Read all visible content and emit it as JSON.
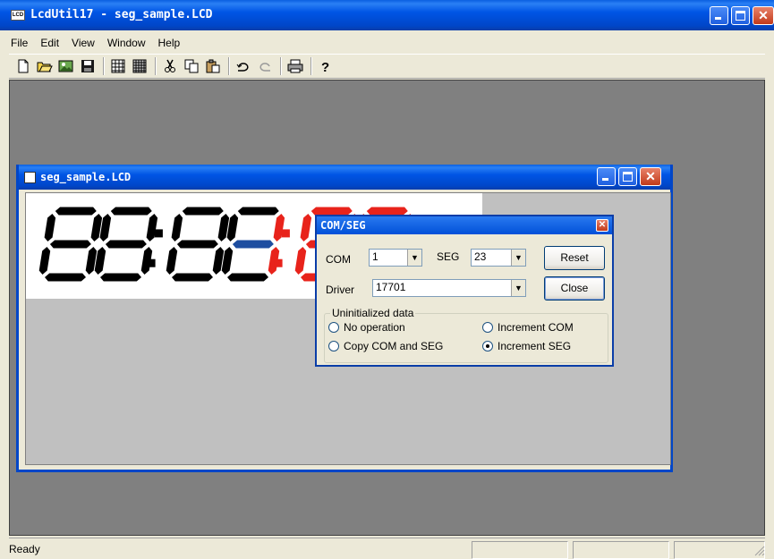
{
  "app": {
    "title": "LcdUtil17 - seg_sample.LCD",
    "icon_text": "LCD"
  },
  "menu": [
    "File",
    "Edit",
    "View",
    "Window",
    "Help"
  ],
  "toolbar_icons": [
    "new-icon",
    "open-icon",
    "image-icon",
    "save-icon",
    "grid-icon",
    "grid-alt-icon",
    "cut-icon",
    "copy-icon",
    "paste-icon",
    "undo-icon",
    "redo-icon",
    "print-icon",
    "help-icon"
  ],
  "child": {
    "title": "seg_sample.LCD"
  },
  "lcd": {
    "text": "88:88:88",
    "colors": {
      "off": "#000000",
      "active": "#E8231B",
      "selected": "#1E4EA0"
    }
  },
  "dialog": {
    "title": "COM/SEG",
    "com_label": "COM",
    "com_value": "1",
    "seg_label": "SEG",
    "seg_value": "23",
    "driver_label": "Driver",
    "driver_value": "17701",
    "reset_label": "Reset",
    "close_label": "Close",
    "group_label": "Uninitialized data",
    "options": {
      "no_op": "No operation",
      "inc_com": "Increment COM",
      "copy": "Copy COM and SEG",
      "inc_seg": "Increment SEG"
    },
    "selected_option": "inc_seg"
  },
  "status": {
    "text": "Ready"
  }
}
